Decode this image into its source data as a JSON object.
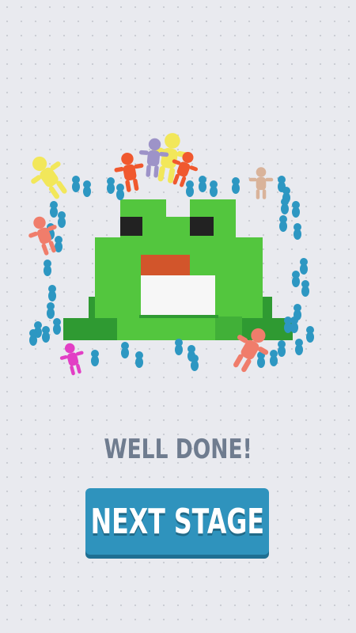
{
  "game": {
    "result_text": "WELL DONE!",
    "next_button_label": "NEXT STAGE",
    "artwork_subject": "frog"
  },
  "colors": {
    "background": "#e9eaef",
    "frog_light_green": "#53c63e",
    "frog_dark_green": "#2f9a32",
    "frog_eye": "#222222",
    "frog_mouth": "#d2552b",
    "frog_belly": "#f7f7f7",
    "crowd_blue": "#2d97c2",
    "button_blue": "#2f93bd",
    "text_gray": "#6f7c8f",
    "npc_yellow": "#f2e75a",
    "npc_orange_red": "#f0582e",
    "npc_lavender": "#9d93c8",
    "npc_salmon": "#f07d6b",
    "npc_tan": "#d9b39a",
    "npc_magenta": "#e23fc5"
  },
  "crowd": {
    "unit_color_name": "blue",
    "npc_color_names": [
      "yellow",
      "orange-red",
      "lavender",
      "salmon",
      "tan",
      "magenta"
    ]
  }
}
